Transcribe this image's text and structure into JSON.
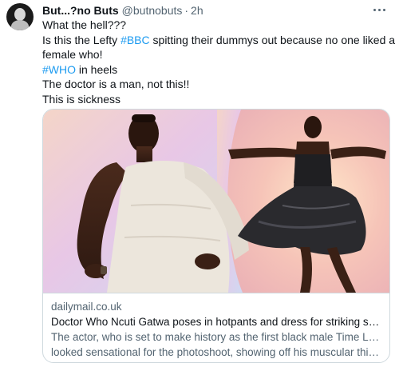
{
  "tweet": {
    "display_name": "But...?no Buts",
    "handle": "@butnobuts",
    "separator": "·",
    "time": "2h",
    "lines": {
      "l1": "What the hell???",
      "l2_pre": "Is this the Lefty ",
      "l2_hashtag": "#BBC",
      "l2_post": " spitting their dummys out because no one liked a",
      "l3": "female who!",
      "l4_hashtag": "#WHO",
      "l4_post": " in heels",
      "l5": "The doctor is a man, not this!!",
      "l6": "This is sickness"
    }
  },
  "card": {
    "domain": "dailymail.co.uk",
    "title": "Doctor Who Ncuti Gatwa poses in hotpants and dress for striking sna...",
    "description_l1": "The actor, who is set to make history as the first black male Time Lord,",
    "description_l2": "looked sensational for the photoshoot, showing off his muscular thig..."
  },
  "icons": {
    "more": "more-horizontal-icon",
    "avatar": "profile-avatar"
  },
  "colors": {
    "text": "#0f1419",
    "secondary": "#536471",
    "link": "#1d9bf0",
    "border": "#cfd9de"
  }
}
